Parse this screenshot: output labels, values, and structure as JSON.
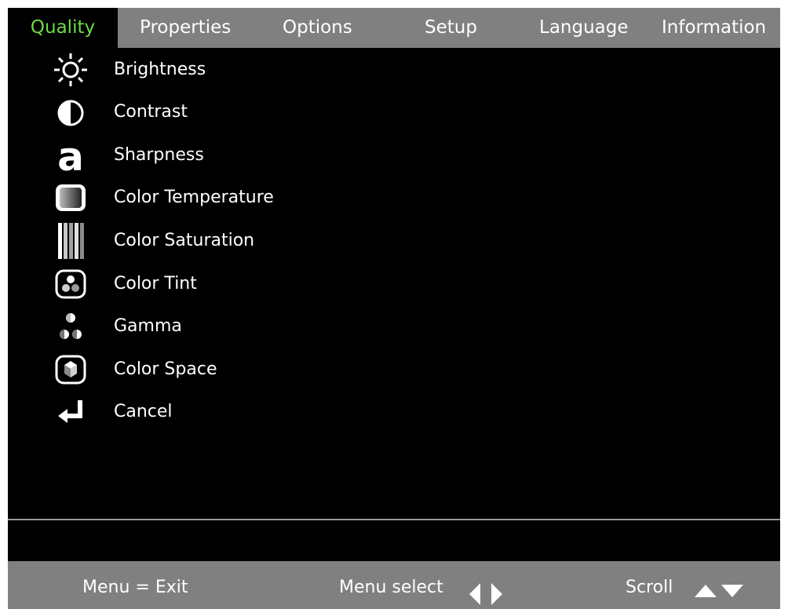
{
  "tabs": [
    {
      "label": "Quality",
      "active": true
    },
    {
      "label": "Properties",
      "active": false
    },
    {
      "label": "Options",
      "active": false
    },
    {
      "label": "Setup",
      "active": false
    },
    {
      "label": "Language",
      "active": false
    },
    {
      "label": "Information",
      "active": false
    }
  ],
  "menu": {
    "items": [
      {
        "label": "Brightness",
        "icon": "sun-icon"
      },
      {
        "label": "Contrast",
        "icon": "half-circle-icon"
      },
      {
        "label": "Sharpness",
        "icon": "letter-a-icon"
      },
      {
        "label": "Color Temperature",
        "icon": "screen-gradient-icon"
      },
      {
        "label": "Color Saturation",
        "icon": "saturation-bars-icon"
      },
      {
        "label": "Color Tint",
        "icon": "tint-dots-icon"
      },
      {
        "label": "Gamma",
        "icon": "gamma-dots-icon"
      },
      {
        "label": "Color Space",
        "icon": "color-cube-icon"
      },
      {
        "label": "Cancel",
        "icon": "return-arrow-icon"
      }
    ]
  },
  "status": {
    "exit_hint": "Menu = Exit",
    "select_hint": "Menu select",
    "scroll_hint": "Scroll"
  },
  "colors": {
    "active_tab_text": "#6fdc42",
    "bar_background": "#808080",
    "screen_background": "#000000",
    "text": "#ffffff"
  }
}
